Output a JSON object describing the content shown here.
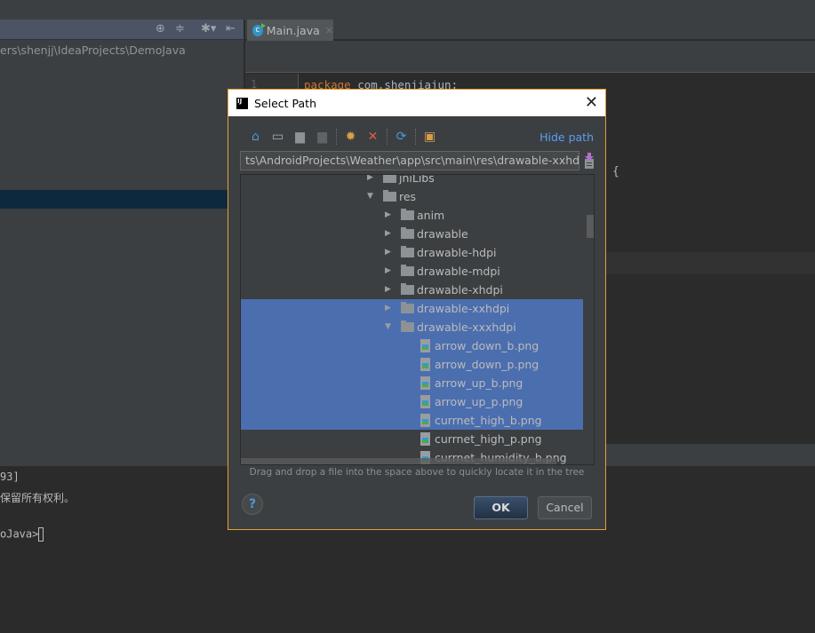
{
  "ide": {
    "project_path": "ers\\shenjj\\IdeaProjects\\DemoJava",
    "project_header_icons": [
      "target-icon",
      "collapse-icon",
      "gear-icon",
      "hide-panel-icon"
    ],
    "editor_tab": {
      "label": "Main.java",
      "icon": "java-class-icon"
    },
    "code": {
      "line_number": "1",
      "keyword": "package",
      "rest": " com.shenjiajun;"
    },
    "brace": "{",
    "terminal_lines": [
      "93]",
      "保留所有权利。",
      "",
      "oJava>"
    ]
  },
  "dialog": {
    "title": "Select Path",
    "toolbar": [
      {
        "name": "home-icon",
        "glyph": "⌂",
        "color": "#4b9ad6"
      },
      {
        "name": "desktop-icon",
        "glyph": "▭",
        "color": "#a9b0b5"
      },
      {
        "name": "project-folder-icon",
        "glyph": "▆",
        "color": "#8c9296"
      },
      {
        "name": "module-folder-icon",
        "glyph": "▆",
        "color": "#5f6366"
      },
      {
        "name": "new-folder-icon",
        "glyph": "✹",
        "color": "#d9a343"
      },
      {
        "name": "delete-icon",
        "glyph": "✕",
        "color": "#e05a4a"
      },
      {
        "name": "refresh-icon",
        "glyph": "⟳",
        "color": "#4b9ad6"
      },
      {
        "name": "show-hidden-icon",
        "glyph": "▣",
        "color": "#d39b4b"
      }
    ],
    "hide_path_label": "Hide path",
    "path_value": "ts\\AndroidProjects\\Weather\\app\\src\\main\\res\\drawable-xxhdpi",
    "tree": [
      {
        "label": "jniLibs",
        "type": "folder",
        "depth": 0,
        "expanded": false,
        "selected": false
      },
      {
        "label": "res",
        "type": "folder",
        "depth": 0,
        "expanded": true,
        "selected": false
      },
      {
        "label": "anim",
        "type": "folder",
        "depth": 1,
        "expanded": false,
        "selected": false
      },
      {
        "label": "drawable",
        "type": "folder",
        "depth": 1,
        "expanded": false,
        "selected": false
      },
      {
        "label": "drawable-hdpi",
        "type": "folder",
        "depth": 1,
        "expanded": false,
        "selected": false
      },
      {
        "label": "drawable-mdpi",
        "type": "folder",
        "depth": 1,
        "expanded": false,
        "selected": false
      },
      {
        "label": "drawable-xhdpi",
        "type": "folder",
        "depth": 1,
        "expanded": false,
        "selected": false
      },
      {
        "label": "drawable-xxhdpi",
        "type": "folder",
        "depth": 1,
        "expanded": false,
        "selected": true
      },
      {
        "label": "drawable-xxxhdpi",
        "type": "folder",
        "depth": 1,
        "expanded": true,
        "selected": true
      },
      {
        "label": "arrow_down_b.png",
        "type": "file",
        "depth": 2,
        "selected": true
      },
      {
        "label": "arrow_down_p.png",
        "type": "file",
        "depth": 2,
        "selected": true
      },
      {
        "label": "arrow_up_b.png",
        "type": "file",
        "depth": 2,
        "selected": true
      },
      {
        "label": "arrow_up_p.png",
        "type": "file",
        "depth": 2,
        "selected": true
      },
      {
        "label": "currnet_high_b.png",
        "type": "file",
        "depth": 2,
        "selected": true
      },
      {
        "label": "currnet_high_p.png",
        "type": "file",
        "depth": 2,
        "selected": false
      },
      {
        "label": "currnet_humidity_b.png",
        "type": "file",
        "depth": 2,
        "selected": false
      }
    ],
    "hint": "Drag and drop a file into the space above to quickly locate it in the tree",
    "help_label": "?",
    "ok_label": "OK",
    "cancel_label": "Cancel",
    "colors": {
      "accent_border": "#e4a032",
      "selection": "#4b6eaf",
      "link": "#589df6"
    }
  }
}
